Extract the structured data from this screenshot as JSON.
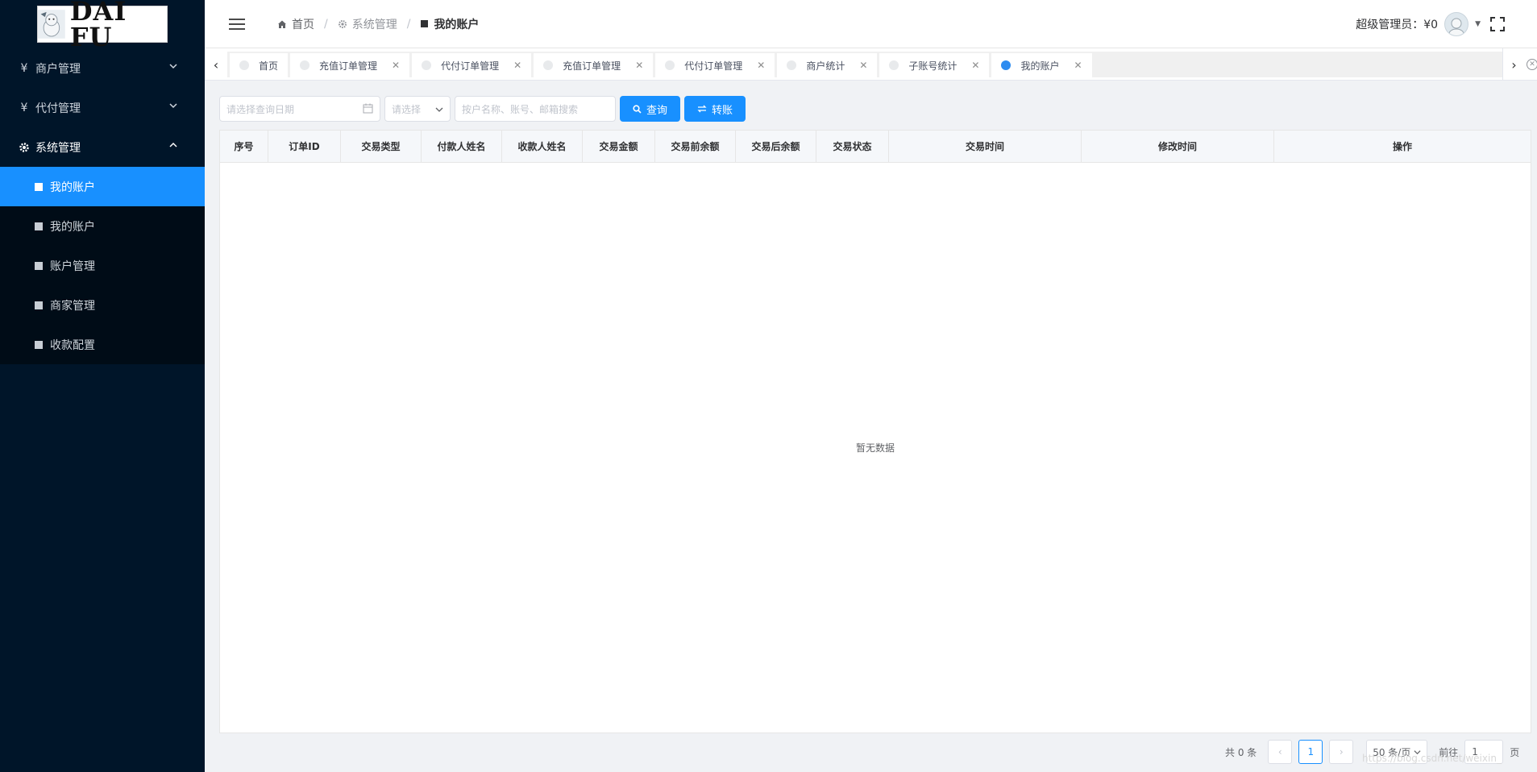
{
  "brand": {
    "logo_text": "DAI FU"
  },
  "sidebar": {
    "groups": [
      {
        "label": "商户管理",
        "icon": "yen-icon",
        "expanded": false
      },
      {
        "label": "代付管理",
        "icon": "yen-icon",
        "expanded": false
      },
      {
        "label": "系统管理",
        "icon": "gear-icon",
        "expanded": true
      }
    ],
    "sub_items": [
      {
        "label": "我的账户",
        "active": true
      },
      {
        "label": "我的账户",
        "active": false
      },
      {
        "label": "账户管理",
        "active": false
      },
      {
        "label": "商家管理",
        "active": false
      },
      {
        "label": "收款配置",
        "active": false
      }
    ]
  },
  "header": {
    "breadcrumb": [
      "首页",
      "系统管理",
      "我的账户"
    ],
    "user_label": "超级管理员：¥0"
  },
  "tabs": [
    {
      "label": "首页",
      "closable": false,
      "active": false
    },
    {
      "label": "充值订单管理",
      "closable": true,
      "active": false
    },
    {
      "label": "代付订单管理",
      "closable": true,
      "active": false
    },
    {
      "label": "充值订单管理",
      "closable": true,
      "active": false
    },
    {
      "label": "代付订单管理",
      "closable": true,
      "active": false
    },
    {
      "label": "商户统计",
      "closable": true,
      "active": false
    },
    {
      "label": "子账号统计",
      "closable": true,
      "active": false
    },
    {
      "label": "我的账户",
      "closable": true,
      "active": true
    }
  ],
  "toolbar": {
    "date_placeholder": "请选择查询日期",
    "select_placeholder": "请选择",
    "search_placeholder": "按户名称、账号、邮箱搜索",
    "query_label": "查询",
    "transfer_label": "转账"
  },
  "table": {
    "columns": [
      "序号",
      "订单ID",
      "交易类型",
      "付款人姓名",
      "收款人姓名",
      "交易金额",
      "交易前余额",
      "交易后余额",
      "交易状态",
      "交易时间",
      "修改时间",
      "操作"
    ],
    "empty_text": "暂无数据"
  },
  "pagination": {
    "total_text": "共 0 条",
    "current_page": "1",
    "page_size_text": "50 条/页",
    "goto_label": "前往",
    "goto_value": "1",
    "page_suffix": "页"
  },
  "watermark": "https://blog.csdn.net/weixin_"
}
